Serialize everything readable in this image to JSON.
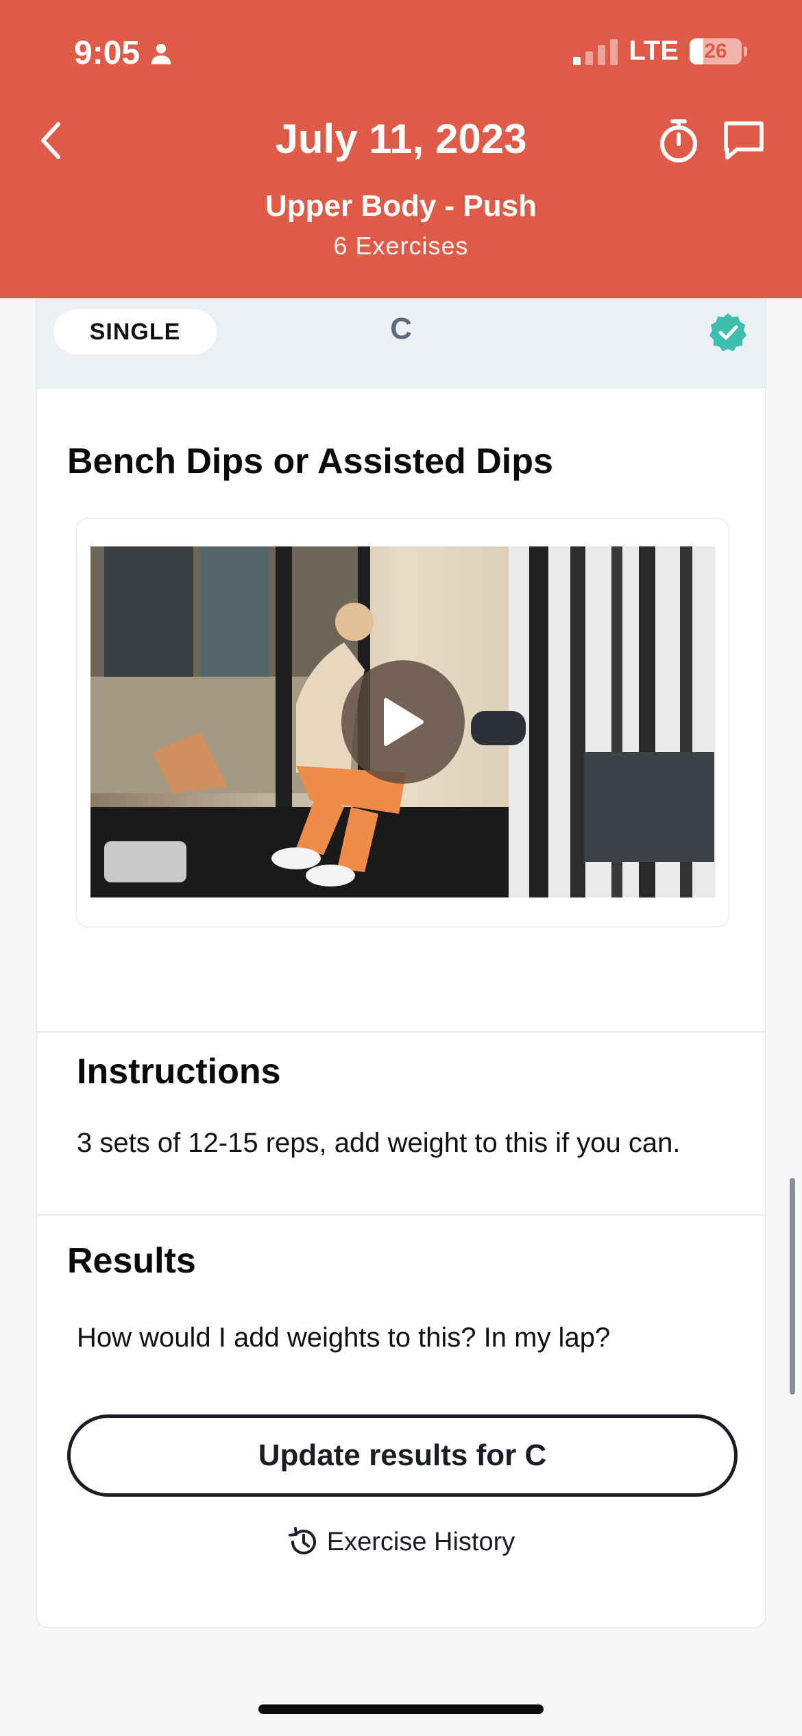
{
  "status_bar": {
    "time": "9:05",
    "network": "LTE",
    "battery": "26",
    "battery_level": 0.26
  },
  "header": {
    "date": "July 11, 2023",
    "workout_name": "Upper Body - Push",
    "exercise_count": "6 Exercises",
    "background_color": "#e05a48"
  },
  "exercise": {
    "type_badge": "SINGLE",
    "letter": "C",
    "completed": true,
    "name": "Bench Dips or Assisted Dips",
    "video_icon": "play-icon"
  },
  "instructions": {
    "heading": "Instructions",
    "text": "3 sets of 12-15 reps, add weight to this if you can."
  },
  "results": {
    "heading": "Results",
    "text": "How would I add weights to this? In my lap?",
    "update_button": "Update results for C",
    "history_link": "Exercise History"
  },
  "colors": {
    "accent": "#e05a48",
    "check": "#3dbfb0",
    "button_border": "#1a1d26"
  }
}
